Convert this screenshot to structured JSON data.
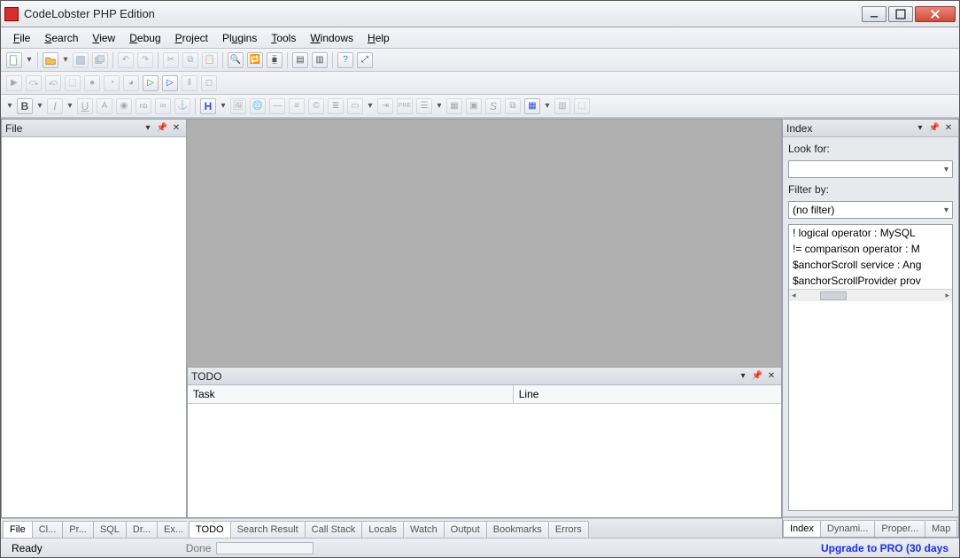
{
  "title": "CodeLobster PHP Edition",
  "menus": [
    "File",
    "Search",
    "View",
    "Debug",
    "Project",
    "Plugins",
    "Tools",
    "Windows",
    "Help"
  ],
  "panels": {
    "file": {
      "title": "File"
    },
    "index": {
      "title": "Index",
      "look_for_label": "Look for:",
      "look_for_value": "",
      "filter_by_label": "Filter by:",
      "filter_by_value": "(no filter)",
      "list": [
        "! logical operator : MySQL",
        "!= comparison operator : M",
        "$anchorScroll service : Ang",
        "$anchorScrollProvider prov"
      ],
      "tabs": [
        "Index",
        "Dynami...",
        "Proper...",
        "Map"
      ]
    },
    "todo": {
      "title": "TODO",
      "columns": [
        "Task",
        "Line"
      ]
    }
  },
  "left_tabs": [
    "File",
    "Cl...",
    "Pr...",
    "SQL",
    "Dr...",
    "Ex..."
  ],
  "bottom_tabs": [
    "TODO",
    "Search Result",
    "Call Stack",
    "Locals",
    "Watch",
    "Output",
    "Bookmarks",
    "Errors"
  ],
  "status": {
    "ready": "Ready",
    "done": "Done",
    "upgrade": "Upgrade to PRO (30 days"
  }
}
